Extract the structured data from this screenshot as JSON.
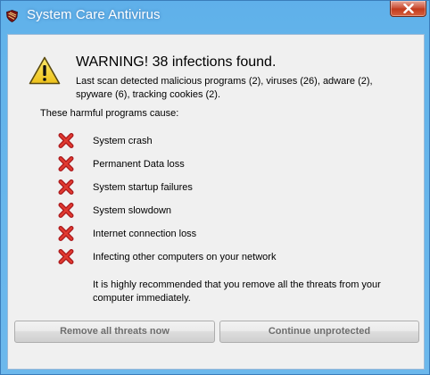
{
  "window": {
    "title": "System Care Antivirus",
    "icon": "shield-icon",
    "close_icon": "close-icon"
  },
  "dialog": {
    "icon": "warning-icon",
    "heading": "WARNING! 38 infections found.",
    "summary": "Last scan detected malicious programs (2), viruses (26), adware (2), spyware (6), tracking cookies (2).",
    "causes_label": "These harmful programs cause:",
    "threats": [
      "System crash",
      "Permanent Data loss",
      "System startup failures",
      "System slowdown",
      "Internet connection loss",
      "Infecting other computers on your network"
    ],
    "threat_icon": "red-x-icon",
    "recommendation": "It is highly recommended that you remove all the threats from your computer immediately.",
    "buttons": {
      "remove": "Remove all threats now",
      "continue": "Continue unprotected"
    }
  },
  "colors": {
    "frame": "#62b3ea",
    "client_bg": "#f0f0f0",
    "close_button": "#c94b31",
    "x_mark": "#c8201c",
    "warning_fill": "#f6d62b"
  }
}
